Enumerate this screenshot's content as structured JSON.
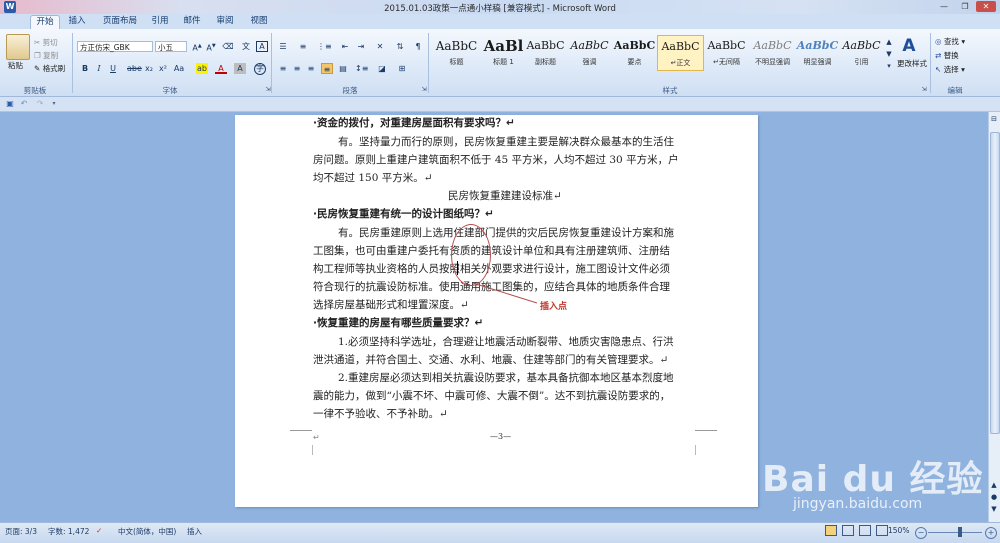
{
  "window": {
    "title": "2015.01.03政策一点通小样稿 [兼容模式] - Microsoft Word"
  },
  "tabs": [
    "开始",
    "插入",
    "页面布局",
    "引用",
    "邮件",
    "审阅",
    "视图"
  ],
  "clipboard": {
    "paste": "粘贴",
    "cut": "剪切",
    "copy": "复制",
    "format_painter": "格式刷",
    "label": "剪贴板"
  },
  "font": {
    "name": "方正仿宋_GBK",
    "size": "小五",
    "label": "字体"
  },
  "paragraph": {
    "label": "段落"
  },
  "styles": {
    "label": "样式",
    "items": [
      {
        "sample": "AaBbC",
        "name": "标题"
      },
      {
        "sample": "AaBl",
        "name": "标题 1"
      },
      {
        "sample": "AaBbC",
        "name": "副标题"
      },
      {
        "sample": "AaBbC",
        "name": "强调"
      },
      {
        "sample": "AaBbC",
        "name": "要点"
      },
      {
        "sample": "AaBbC",
        "name": "↵正文"
      },
      {
        "sample": "AaBbC",
        "name": "↵无间隔"
      },
      {
        "sample": "AaBbC",
        "name": "不明显强调"
      },
      {
        "sample": "AaBbC",
        "name": "明显强调"
      },
      {
        "sample": "AaBbC",
        "name": "引用"
      }
    ],
    "change": "更改样式"
  },
  "editing": {
    "find": "查找",
    "replace": "替换",
    "select": "选择",
    "label": "编辑"
  },
  "document": {
    "lines": [
      "·资金的拨付，对重建房屋面积有要求吗？↵",
      "有。坚持量力而行的原则，民房恢复重建主要是解决群众最基本的生活住",
      "房问题。原则上重建户建筑面积不低于 45 平方米，人均不超过 30 平方米，户",
      "均不超过 150 平方米。↵",
      "民房恢复重建建设标准↵",
      "·民房恢复重建有统一的设计图纸吗？↵",
      "有。民房重建原则上选用住建部门提供的灾后民房恢复重建设计方案和施",
      "工图集，也可由重建户委托有资质的建筑设计单位和具有注册建筑师、注册结",
      "构工程师等执业资格的人员按照相关外观要求进行设计，施工图设计文件必须",
      "符合现行的抗震设防标准。使用通用施工图集的，应结合具体的地质条件合理",
      "选择房屋基础形式和埋置深度。↵",
      "·恢复重建的房屋有哪些质量要求？↵",
      "1.必须坚持科学选址，合理避让地震活动断裂带、地质灾害隐患点、行洪",
      "泄洪通道，并符合国土、交通、水利、地震、住建等部门的有关管理要求。↵",
      "2.重建房屋必须达到相关抗震设防要求，基本具备抗御本地区基本烈度地",
      "震的能力，做到“小震不坏、中震可修、大震不倒”。达不到抗震设防要求的，",
      "一律不予验收、不予补助。↵"
    ],
    "footer_page": "—3—",
    "annotation": "插入点"
  },
  "status": {
    "page": "页面: 3/3",
    "words": "字数: 1,472",
    "language": "中文(简体，中国)",
    "mode": "插入",
    "zoom": "150%"
  },
  "watermark": {
    "logo": "Bai du 经验",
    "url": "jingyan.baidu.com"
  }
}
